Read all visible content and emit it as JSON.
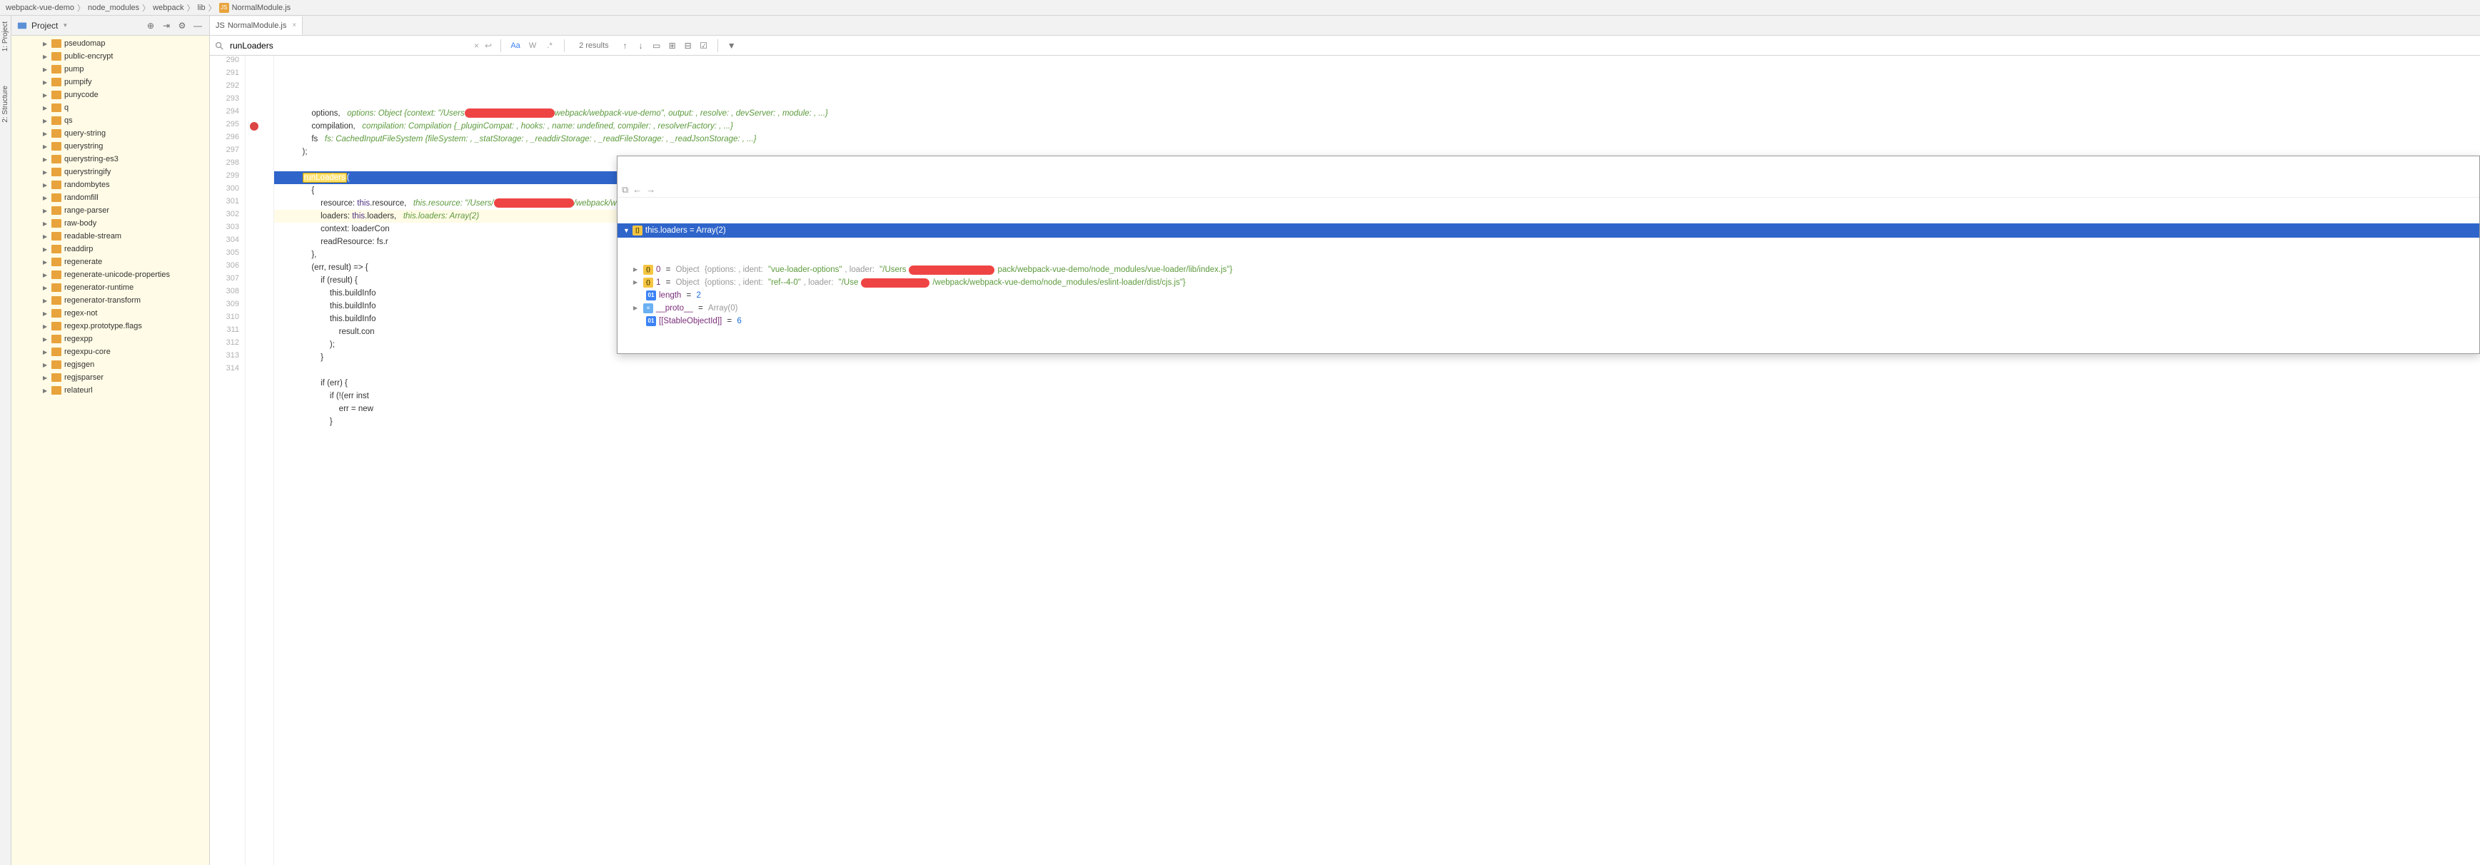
{
  "breadcrumb": {
    "items": [
      "webpack-vue-demo",
      "node_modules",
      "webpack",
      "lib"
    ],
    "file": "NormalModule.js"
  },
  "side_tabs": {
    "project": "1: Project",
    "structure": "2: Structure"
  },
  "project_header": {
    "label": "Project"
  },
  "tree_items": [
    "pseudomap",
    "public-encrypt",
    "pump",
    "pumpify",
    "punycode",
    "q",
    "qs",
    "query-string",
    "querystring",
    "querystring-es3",
    "querystringify",
    "randombytes",
    "randomfill",
    "range-parser",
    "raw-body",
    "readable-stream",
    "readdirp",
    "regenerate",
    "regenerate-unicode-properties",
    "regenerator-runtime",
    "regenerator-transform",
    "regex-not",
    "regexp.prototype.flags",
    "regexpp",
    "regexpu-core",
    "regjsgen",
    "regjsparser",
    "relateurl"
  ],
  "tab": {
    "label": "NormalModule.js"
  },
  "find": {
    "query": "runLoaders",
    "results": "2 results",
    "match_case_active": true,
    "placeholder": ""
  },
  "tooltip_label": "this.loaders",
  "code": {
    "lines": [
      {
        "n": 290,
        "text": "            options,   ",
        "hint": "options: Object {context: \"/Users",
        "redact": 18,
        "hint2": "webpack/webpack-vue-demo\", output: , resolve: , devServer: , module: , ...}"
      },
      {
        "n": 291,
        "text": "            compilation,   ",
        "hint": "compilation: Compilation {_pluginCompat: , hooks: , name: undefined, compiler: , resolverFactory: , ...}"
      },
      {
        "n": 292,
        "text": "            fs   ",
        "hint": "fs: CachedInputFileSystem {fileSystem: , _statStorage: , _readdirStorage: , _readFileStorage: , _readJsonStorage: , ...}"
      },
      {
        "n": 293,
        "text": "        );"
      },
      {
        "n": 294,
        "text": ""
      },
      {
        "n": 295,
        "text": "        ",
        "match": "runLoaders",
        "after": "(",
        "hl": true,
        "bp": true
      },
      {
        "n": 296,
        "text": "            {"
      },
      {
        "n": 297,
        "text": "                resource: ",
        "this": "this",
        "prop": ".resource,   ",
        "hint": "this.resource: \"/Users/",
        "redact": 16,
        "hint2": "/webpack/webpack-vue-demo/src/app.vue\""
      },
      {
        "n": 298,
        "text": "                loaders: ",
        "this": "this",
        "prop": ".loaders,   ",
        "hint": "this.loaders: Array(2)",
        "cur": true,
        "bulb": true
      },
      {
        "n": 299,
        "text": "                context: loaderCon"
      },
      {
        "n": 300,
        "text": "                readResource: fs.r"
      },
      {
        "n": 301,
        "text": "            },"
      },
      {
        "n": 302,
        "text": "            (err, result) => {"
      },
      {
        "n": 303,
        "text": "                if (result) {"
      },
      {
        "n": 304,
        "text": "                    this.buildInfo"
      },
      {
        "n": 305,
        "text": "                    this.buildInfo"
      },
      {
        "n": 306,
        "text": "                    this.buildInfo"
      },
      {
        "n": 307,
        "text": "                        result.con"
      },
      {
        "n": 308,
        "text": "                    );"
      },
      {
        "n": 309,
        "text": "                }"
      },
      {
        "n": 310,
        "text": ""
      },
      {
        "n": 311,
        "text": "                if (err) {"
      },
      {
        "n": 312,
        "text": "                    if (!(err inst"
      },
      {
        "n": 313,
        "text": "                        err = new "
      },
      {
        "n": 314,
        "text": "                    }"
      }
    ]
  },
  "debug": {
    "title": "this.loaders = Array(2)",
    "rows": [
      {
        "idx": "0",
        "type": "Object",
        "detail_pre": "{options: , ident: ",
        "ident": "\"vue-loader-options\"",
        "loader_pre": ", loader: ",
        "loader": "\"/Users",
        "redact": 20,
        "loader_post": "pack/webpack-vue-demo/node_modules/vue-loader/lib/index.js\"}"
      },
      {
        "idx": "1",
        "type": "Object",
        "detail_pre": "{options: , ident: ",
        "ident": "\"ref--4-0\"",
        "loader_pre": ", loader: ",
        "loader": "\"/Use",
        "redact": 16,
        "loader_post": "/webpack/webpack-vue-demo/node_modules/eslint-loader/dist/cjs.js\"}"
      }
    ],
    "length": {
      "label": "length",
      "val": "2"
    },
    "proto": {
      "label": "__proto__",
      "val": "Array(0)"
    },
    "stable": {
      "label": "[[StableObjectId]]",
      "val": "6"
    }
  }
}
